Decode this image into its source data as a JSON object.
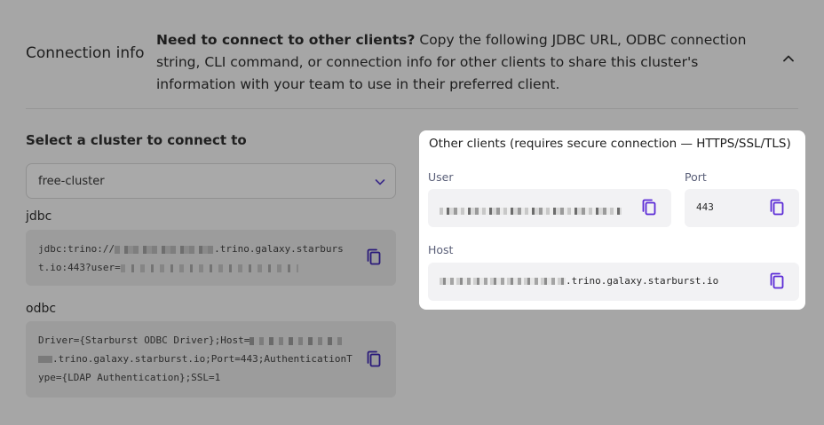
{
  "header": {
    "section_title": "Connection info",
    "description_bold": "Need to connect to other clients?",
    "description_rest": " Copy the following JDBC URL, ODBC connection string, CLI command, or connection info for other clients to share this cluster's information with your team to use in their preferred client."
  },
  "cluster": {
    "label": "Select a cluster to connect to",
    "selected": "free-cluster"
  },
  "jdbc": {
    "label": "jdbc",
    "prefix": "jdbc:trino://",
    "middle": ".trino.galaxy.starburst.io:443?user="
  },
  "odbc": {
    "label": "odbc",
    "prefix": "Driver={Starburst ODBC Driver};Host=",
    "suffix": ".trino.galaxy.starburst.io;Port=443;AuthenticationType={LDAP Authentication};SSL=1"
  },
  "other_clients": {
    "title": "Other clients (requires secure connection — HTTPS/SSL/TLS)",
    "user_label": "User",
    "port_label": "Port",
    "port_value": "443",
    "host_label": "Host",
    "host_suffix": ".trino.galaxy.starburst.io"
  },
  "colors": {
    "accent": "#5b2bd6",
    "overlay_bg": "#a6a6a6",
    "panel_bg": "#ffffff"
  },
  "icons": {
    "copy": "copy-icon",
    "chevron_up": "chevron-up-icon",
    "chevron_down": "chevron-down-icon"
  }
}
